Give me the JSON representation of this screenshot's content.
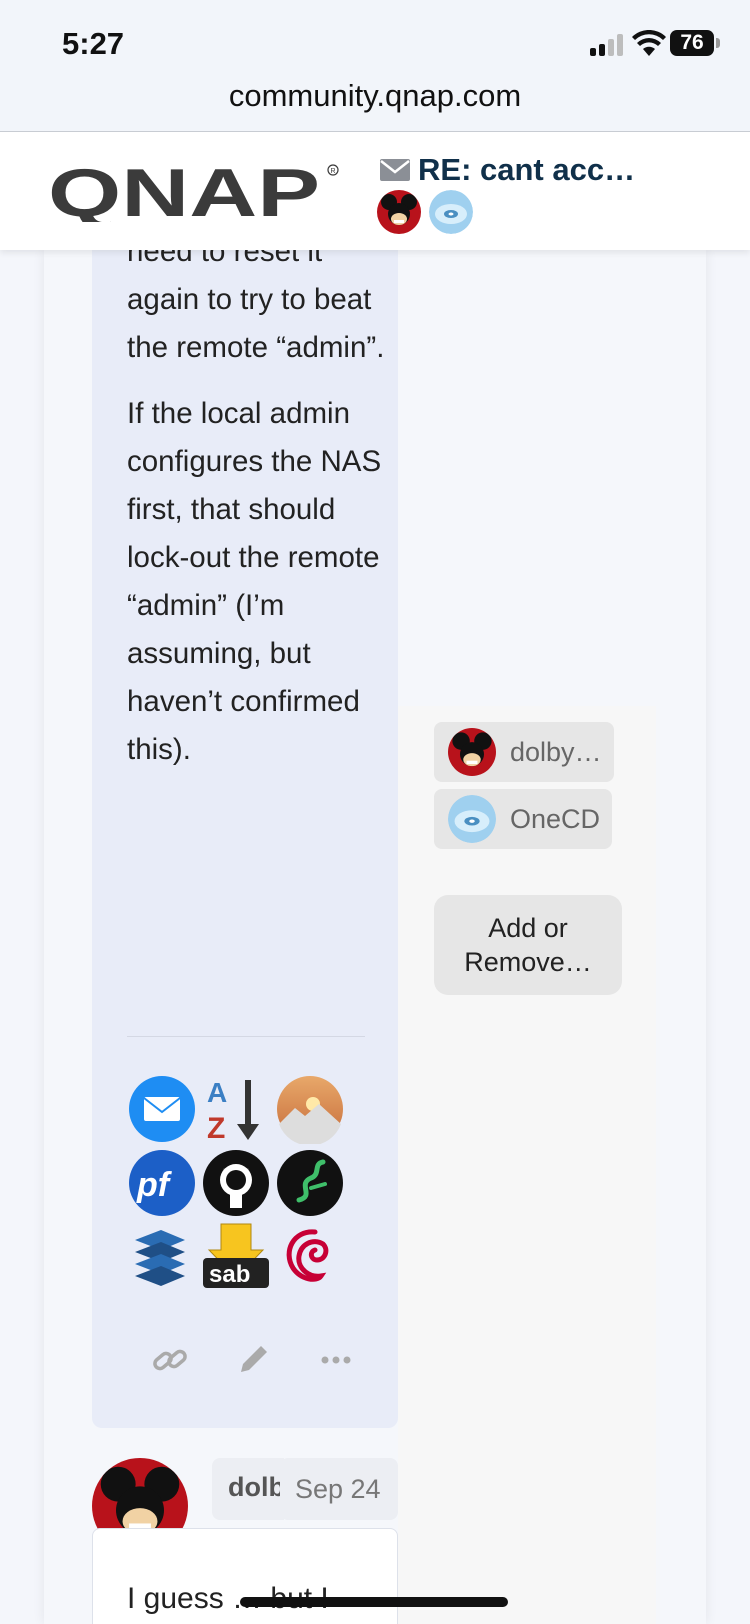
{
  "status_bar": {
    "time": "5:27",
    "battery": "76"
  },
  "browser": {
    "url": "community.qnap.com"
  },
  "header": {
    "brand": "QNAP",
    "topic_title": "RE: cant acc…",
    "participants": [
      "dolby",
      "OneCD"
    ]
  },
  "post": {
    "paragraphs": [
      "local admin would need to reset it again to try to beat the remote “admin”.",
      "If the local admin configures the NAS first, that should lock-out the remote “admin” (I’m assuming, but haven’t confirmed this)."
    ],
    "signature_icons": [
      "mail-icon",
      "sort-az-icon",
      "sunset-mountain-icon",
      "pfsense-icon",
      "github-icon",
      "snake-icon",
      "server-stack-icon",
      "sabnzbd-icon",
      "debian-icon"
    ],
    "sab_label": "sab",
    "actions": [
      "link-icon",
      "pencil-icon",
      "more-icon"
    ]
  },
  "sidebar": {
    "members": [
      {
        "name": "dolby…"
      },
      {
        "name": "OneCD"
      }
    ],
    "add_remove_label": "Add or Remove…"
  },
  "reply": {
    "author": "dolby",
    "date": "Sep 24",
    "text": "I guess … but I"
  }
}
